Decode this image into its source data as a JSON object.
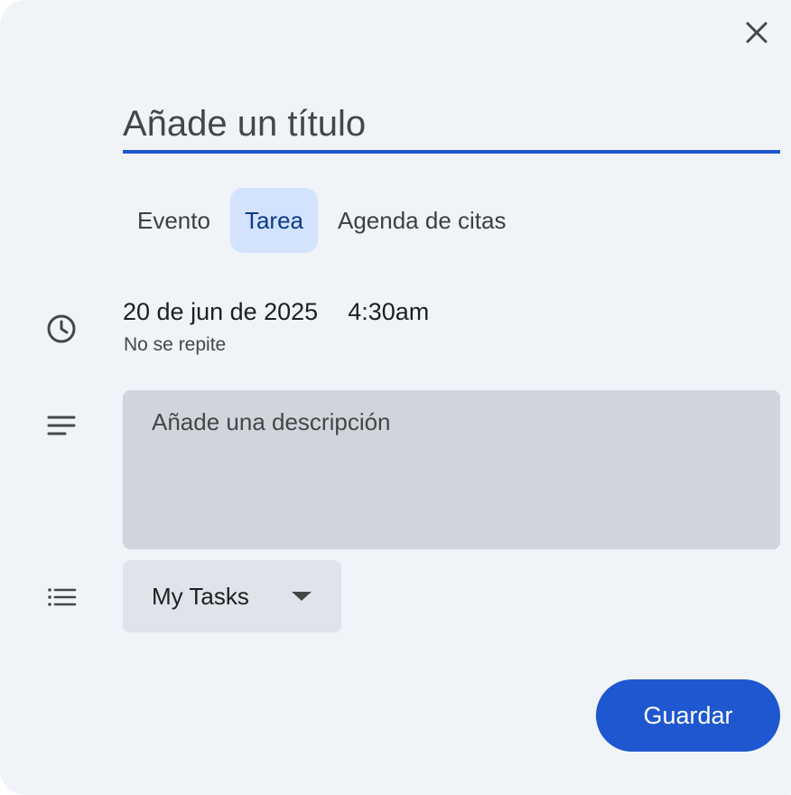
{
  "dialog": {
    "close_icon": "close-icon",
    "title_placeholder": "Añade un título",
    "tabs": [
      {
        "label": "Evento",
        "selected": false
      },
      {
        "label": "Tarea",
        "selected": true
      },
      {
        "label": "Agenda de citas",
        "selected": false
      }
    ],
    "datetime": {
      "icon": "clock-icon",
      "date": "20 de jun de 2025",
      "time": "4:30am",
      "repeat": "No se repite"
    },
    "description": {
      "icon": "notes-icon",
      "placeholder": "Añade una descripción"
    },
    "task_list": {
      "icon": "list-icon",
      "selected": "My Tasks",
      "dropdown_icon": "caret-down-icon"
    },
    "save_label": "Guardar"
  },
  "colors": {
    "accent": "#1f57d0",
    "selected_tab_bg": "#d3e3fd",
    "dialog_bg": "#f0f4f9"
  }
}
